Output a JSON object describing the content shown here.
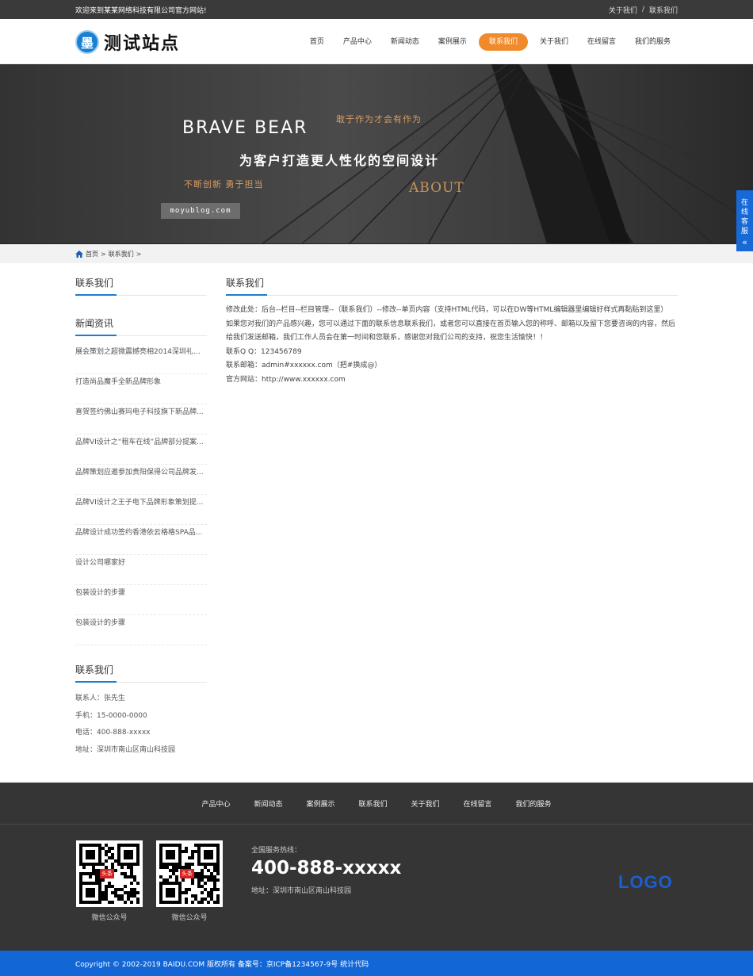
{
  "topbar": {
    "welcome": "欢迎来到某某网络科技有限公司官方网站!",
    "links": [
      "关于我们",
      "联系我们"
    ],
    "separator": "/"
  },
  "header": {
    "logo_char": "墨",
    "logo_text": "测试站点",
    "nav": [
      "首页",
      "产品中心",
      "新闻动态",
      "案例展示",
      "联系我们",
      "关于我们",
      "在线留言",
      "我们的服务"
    ],
    "active_nav": "联系我们"
  },
  "banner": {
    "brave": "BRAVE BEAR",
    "slogan1": "敢于作为才会有作为",
    "main": "为客户打造更人性化的空间设计",
    "sub": "不断创新   勇于担当",
    "about": "ABOUT",
    "url_tag": "moyublog.com"
  },
  "float_service": {
    "chars": [
      "在",
      "线",
      "客",
      "服"
    ],
    "chevron": "«"
  },
  "breadcrumb": {
    "home": "首页",
    "sep": ">",
    "current": "联系我们",
    "trail_sep": ">"
  },
  "sidebar": {
    "section1_title": "联系我们",
    "news_title": "新闻资讯",
    "news": [
      "展会策划之超微震撼亮相2014深圳礼品展",
      "打造尚品魔手全新品牌形象",
      "喜贺签约佛山赛玛电子科技旗下新品牌...",
      "品牌VI设计之“租车在线”品牌部分提案...",
      "品牌策划应邀参加贵阳保得公司品牌发...",
      "品牌VI设计之王子电下品牌形象策划提...",
      "品牌设计成功签约香港依云格格SPA品...",
      "设计公司哪家好",
      "包装设计的步骤",
      "包装设计的步骤"
    ],
    "contact_title": "联系我们",
    "contact": [
      "联系人：张先生",
      "手机：15-0000-0000",
      "电话：400-888-xxxxx",
      "地址：深圳市南山区南山科技园"
    ]
  },
  "content": {
    "title": "联系我们",
    "lines": [
      "修改此处：后台--栏目--栏目管理--（联系我们）--修改--单页内容（支持HTML代码，可以在DW等HTML编辑器里编辑好样式再黏贴到这里）",
      "如果您对我们的产品感兴趣，您可以通过下面的联系信息联系我们，或者您可以直接在首页输入您的称呼、邮箱以及留下您要咨询的内容，然后给我们发送邮箱，我们工作人员会在第一时间和您联系，感谢您对我们公司的支持，祝您生活愉快！！",
      "联系Q Q：123456789",
      "联系邮箱：admin#xxxxxx.com（把#换成@）",
      "官方网站：http://www.xxxxxx.com"
    ]
  },
  "footer": {
    "nav": [
      "产品中心",
      "新闻动态",
      "案例展示",
      "联系我们",
      "关于我们",
      "在线留言",
      "我们的服务"
    ],
    "qr": [
      {
        "caption": "微信公众号",
        "badge": "头条"
      },
      {
        "caption": "微信公众号",
        "badge": "头条"
      }
    ],
    "hotline_label": "全国服务热线：",
    "hotline": "400-888-xxxxx",
    "address": "地址：深圳市南山区南山科技园",
    "logo": "LOGO",
    "copyright": "Copyright © 2002-2019 BAIDU.COM 版权所有 备案号：京ICP备1234567-9号  统计代码"
  },
  "colors": {
    "accent": "#f08a2c",
    "blue": "#1266d6",
    "dark": "#353535"
  }
}
